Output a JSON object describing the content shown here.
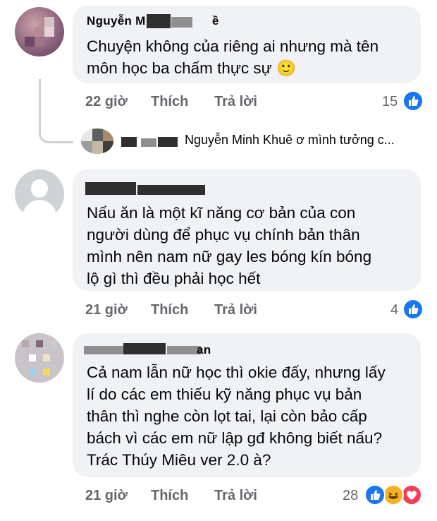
{
  "comments": [
    {
      "author": "Nguyễn M",
      "author_suffix": "ề",
      "text": "Chuyện không của riêng ai nhưng mà tên môn học ba chấm thực sự",
      "emoji": "🙂",
      "time": "22 giờ",
      "like_label": "Thích",
      "reply_label": "Trả lời",
      "reaction_count": "15",
      "reactions": [
        "like-icon"
      ],
      "reply_preview": "Nguyễn Minh Khuê ơ mình tưởng c..."
    },
    {
      "author": "",
      "text": "Nấu ăn là một kĩ năng cơ bản của con\nngười dùng để phục vụ chính bản thân\nmình nên nam nữ gay les bóng kín bóng\nlộ gì thì đều phải học hết",
      "time": "21 giờ",
      "like_label": "Thích",
      "reply_label": "Trả lời",
      "reaction_count": "4",
      "reactions": [
        "like-icon"
      ]
    },
    {
      "author": "an",
      "text": "Cả nam lẫn nữ học thì okie đấy, nhưng lấy\nlí do các em thiếu kỹ năng phục vụ bản\nthân thì nghe còn lọt tai, lại còn bảo cấp\nbách vì các em nữ lập gđ không biết nấu?\nTrác Thúy Miêu ver 2.0 à?",
      "time": "21 giờ",
      "like_label": "Thích",
      "reply_label": "Trả lời",
      "reaction_count": "28",
      "reactions": [
        "like-icon",
        "haha-icon",
        "love-icon"
      ]
    }
  ],
  "colors": {
    "bubble": "#f0f2f5",
    "meta": "#65676b",
    "like": "#1877f2",
    "haha": "#f7b125",
    "love": "#f33e58"
  }
}
